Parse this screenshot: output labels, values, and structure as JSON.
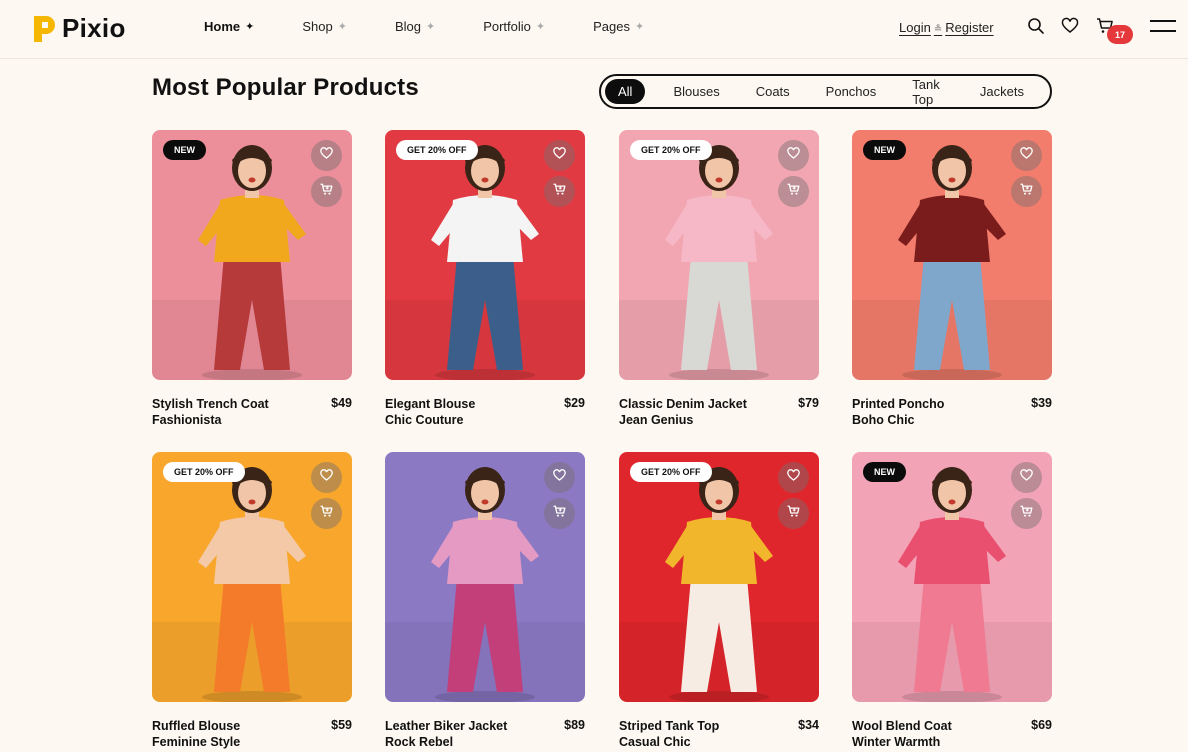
{
  "brand": {
    "name": "Pixio"
  },
  "nav": [
    {
      "label": "Home",
      "active": true
    },
    {
      "label": "Shop"
    },
    {
      "label": "Blog"
    },
    {
      "label": "Portfolio"
    },
    {
      "label": "Pages"
    }
  ],
  "auth": {
    "login": "Login",
    "register": "Register"
  },
  "cart": {
    "count": "17"
  },
  "section": {
    "title": "Most Popular Products"
  },
  "filters": [
    "All",
    "Blouses",
    "Coats",
    "Ponchos",
    "Tank Top",
    "Jackets"
  ],
  "products": [
    {
      "name": "Stylish Trench Coat",
      "brand": "Fashionista",
      "price": "$49",
      "badge": "NEW",
      "bg": "#ec8f9b",
      "top": "#f2a81d",
      "bottom": "#b63a3a"
    },
    {
      "name": "Elegant Blouse",
      "brand": "Chic Couture",
      "price": "$29",
      "badge": "GET 20% OFF",
      "bg": "#e23a42",
      "top": "#f4f4f4",
      "bottom": "#3b5f8a"
    },
    {
      "name": "Classic Denim Jacket",
      "brand": "Jean Genius",
      "price": "$79",
      "badge": "GET 20% OFF",
      "bg": "#f2a6b2",
      "top": "#f6b8c6",
      "bottom": "#d8d8d4"
    },
    {
      "name": "Printed Poncho",
      "brand": "Boho Chic",
      "price": "$39",
      "badge": "NEW",
      "bg": "#f27d6c",
      "top": "#7a1c1c",
      "bottom": "#7fa7cc"
    },
    {
      "name": "Ruffled Blouse",
      "brand": "Feminine Style",
      "price": "$59",
      "badge": "GET 20% OFF",
      "bg": "#f8a72c",
      "top": "#f4c9a8",
      "bottom": "#f47b2a"
    },
    {
      "name": "Leather Biker Jacket",
      "brand": "Rock Rebel",
      "price": "$89",
      "badge": "",
      "bg": "#8c79c4",
      "top": "#e59ac4",
      "bottom": "#c23f7a"
    },
    {
      "name": "Striped Tank Top",
      "brand": "Casual Chic",
      "price": "$34",
      "badge": "GET 20% OFF",
      "bg": "#e0262d",
      "top": "#f2b62c",
      "bottom": "#f6ece4"
    },
    {
      "name": "Wool Blend Coat",
      "brand": "Winter Warmth",
      "price": "$69",
      "badge": "NEW",
      "bg": "#f3a3b6",
      "top": "#e94f6f",
      "bottom": "#f07a92"
    }
  ]
}
